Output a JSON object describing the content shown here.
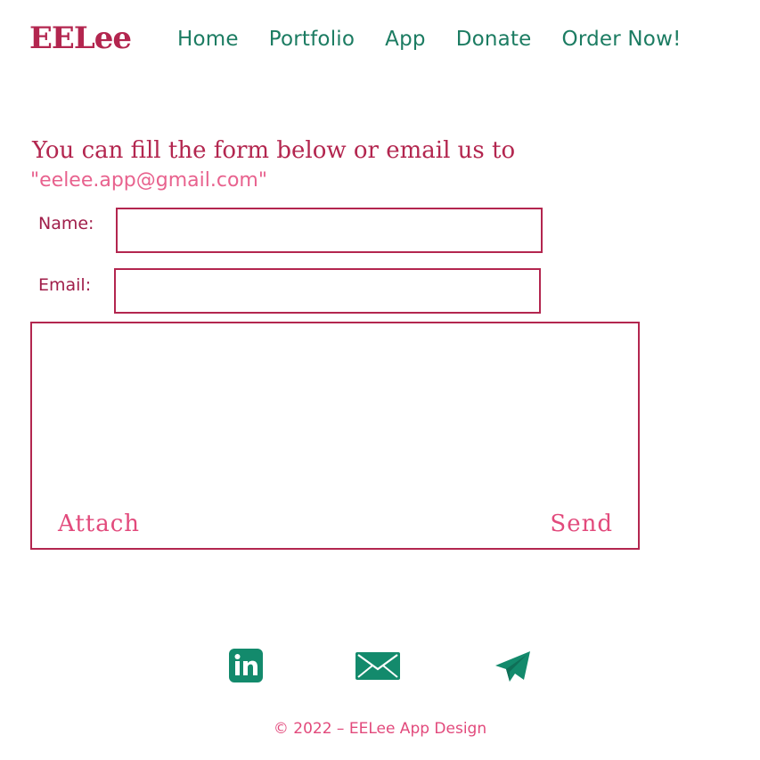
{
  "header": {
    "logo": "EELee",
    "nav": [
      "Home",
      "Portfolio",
      "App",
      "Donate",
      "Order Now!"
    ]
  },
  "intro": {
    "line1": "You can fill the form below or email us to",
    "line2": "\"eelee.app@gmail.com\""
  },
  "form": {
    "name_label": "Name:",
    "name_value": "",
    "email_label": "Email:",
    "email_value": "",
    "message_value": "",
    "attach_label": "Attach",
    "send_label": "Send"
  },
  "social": {
    "icons": [
      "linkedin-icon",
      "mail-icon",
      "telegram-icon"
    ]
  },
  "footer": {
    "text": "© 2022 – EELee App Design"
  },
  "colors": {
    "brand": "#b3264f",
    "accent": "#e24a7c",
    "nav": "#1c7c62",
    "social": "#138a6c"
  }
}
